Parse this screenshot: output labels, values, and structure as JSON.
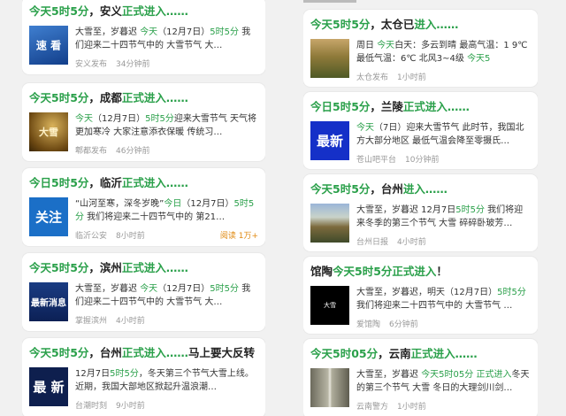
{
  "left": [
    {
      "title_parts": [
        {
          "text": "今天5时5分",
          "c": "g"
        },
        {
          "text": "，安义",
          "c": ""
        },
        {
          "text": "正式进入……",
          "c": "g"
        }
      ],
      "snippet_parts": [
        {
          "text": "大雪至，岁暮迟 ",
          "c": ""
        },
        {
          "text": "今天",
          "c": "g"
        },
        {
          "text": "（12月7日）",
          "c": ""
        },
        {
          "text": "5时5分",
          "c": "g"
        },
        {
          "text": " 我们迎来二十四节气中的 大雪节气 大…",
          "c": ""
        }
      ],
      "thumb": {
        "label": "速 看",
        "kind": "blue-grad"
      },
      "source": "安义发布",
      "time": "34分钟前"
    },
    {
      "title_parts": [
        {
          "text": "今天5时5分",
          "c": "g"
        },
        {
          "text": "，成都",
          "c": ""
        },
        {
          "text": "正式进入……",
          "c": "g"
        }
      ],
      "snippet_parts": [
        {
          "text": "今天",
          "c": "g"
        },
        {
          "text": "（12月7日）",
          "c": ""
        },
        {
          "text": "5时5分",
          "c": "g"
        },
        {
          "text": "迎来大雪节气 天气将更加寒冷 大家注意添衣保暖 传统习…",
          "c": ""
        }
      ],
      "thumb": {
        "label": "大雪",
        "kind": "gold"
      },
      "source": "郫都发布",
      "time": "46分钟前"
    },
    {
      "title_parts": [
        {
          "text": "今日5时5分",
          "c": "g"
        },
        {
          "text": "，临沂",
          "c": ""
        },
        {
          "text": "正式进入……",
          "c": "g"
        }
      ],
      "snippet_parts": [
        {
          "text": "“山河至寒，深冬岁晚”",
          "c": ""
        },
        {
          "text": "今日",
          "c": "g"
        },
        {
          "text": "（12月7日）",
          "c": ""
        },
        {
          "text": "5时5分",
          "c": "g"
        },
        {
          "text": " 我们将迎来二十四节气中的 第21…",
          "c": ""
        }
      ],
      "thumb": {
        "label": "关注",
        "kind": "blue"
      },
      "source": "临沂公安",
      "time": "8小时前",
      "reads": "阅读 1万+"
    },
    {
      "title_parts": [
        {
          "text": "今天5时5分",
          "c": "g"
        },
        {
          "text": "，滨州",
          "c": ""
        },
        {
          "text": "正式进入……",
          "c": "g"
        }
      ],
      "snippet_parts": [
        {
          "text": "大雪至，岁暮迟 ",
          "c": ""
        },
        {
          "text": "今天",
          "c": "g"
        },
        {
          "text": "（12月7日）",
          "c": ""
        },
        {
          "text": "5时5分",
          "c": "g"
        },
        {
          "text": " 我们迎来二十四节气中的 大雪节气 大…",
          "c": ""
        }
      ],
      "thumb": {
        "label": "最新消息",
        "kind": "navy"
      },
      "source": "掌握滨州",
      "time": "4小时前"
    },
    {
      "title_parts": [
        {
          "text": "今天5时5分",
          "c": "g"
        },
        {
          "text": "，台州",
          "c": ""
        },
        {
          "text": "正式进入……",
          "c": "g"
        },
        {
          "text": "马上要大反转",
          "c": ""
        }
      ],
      "snippet_parts": [
        {
          "text": "12月7日",
          "c": ""
        },
        {
          "text": "5时5分",
          "c": "g"
        },
        {
          "text": "，冬天第三个节气大雪上线。近期，我国大部地区掀起升温浪潮…",
          "c": ""
        }
      ],
      "thumb": {
        "label": "最 新",
        "kind": "darknavy"
      },
      "source": "台潮时刻",
      "time": "9小时前"
    }
  ],
  "right": [
    {
      "title_parts": [
        {
          "text": "今天5时5分",
          "c": "g"
        },
        {
          "text": "，太仓已",
          "c": ""
        },
        {
          "text": "进入……",
          "c": "g"
        }
      ],
      "snippet_parts": [
        {
          "text": "周日 ",
          "c": ""
        },
        {
          "text": "今天",
          "c": "g"
        },
        {
          "text": "白天：多云到晴 最高气温：1 9℃ 最低气温：6℃ 北风3~4级 ",
          "c": ""
        },
        {
          "text": "今天5",
          "c": "g"
        }
      ],
      "thumb": {
        "label": "",
        "kind": "field"
      },
      "source": "太仓发布",
      "time": "1小时前"
    },
    {
      "title_parts": [
        {
          "text": "今日5时5分",
          "c": "g"
        },
        {
          "text": "，兰陵",
          "c": ""
        },
        {
          "text": "正式进入……",
          "c": "g"
        }
      ],
      "snippet_parts": [
        {
          "text": "今天",
          "c": "g"
        },
        {
          "text": "（7日）迎来大雪节气 此时节，我国北方大部分地区 最低气温会降至零摄氏…",
          "c": ""
        }
      ],
      "thumb": {
        "label": "最新",
        "kind": "royal"
      },
      "source": "苍山吧平台",
      "time": "10分钟前"
    },
    {
      "title_parts": [
        {
          "text": "今天5时5分",
          "c": "g"
        },
        {
          "text": "，台州",
          "c": ""
        },
        {
          "text": "进入……",
          "c": "g"
        }
      ],
      "snippet_parts": [
        {
          "text": "大雪至，岁暮迟 12月7日",
          "c": ""
        },
        {
          "text": "5时5分",
          "c": "g"
        },
        {
          "text": " 我们将迎来冬季的第三个节气 大雪 碎碎卧玻芳…",
          "c": ""
        }
      ],
      "thumb": {
        "label": "",
        "kind": "village"
      },
      "source": "台州日报",
      "time": "4小时前"
    },
    {
      "title_parts": [
        {
          "text": "馆陶",
          "c": ""
        },
        {
          "text": "今天5时5分正式进入",
          "c": "g"
        },
        {
          "text": "！",
          "c": ""
        }
      ],
      "snippet_parts": [
        {
          "text": "大雪至，岁暮迟，明天（12月7日）",
          "c": ""
        },
        {
          "text": "5时5分",
          "c": "g"
        },
        {
          "text": " 我们将迎来二十四节气中的 大雪节气 …",
          "c": ""
        }
      ],
      "thumb": {
        "label": "大雪",
        "kind": "black"
      },
      "source": "爱馆陶",
      "time": "6分钟前"
    },
    {
      "title_parts": [
        {
          "text": "今天5时05分",
          "c": "g"
        },
        {
          "text": "，云南",
          "c": ""
        },
        {
          "text": "正式进入……",
          "c": "g"
        }
      ],
      "snippet_parts": [
        {
          "text": "大雪至，岁暮迟 ",
          "c": ""
        },
        {
          "text": "今天5时05分 正式进入",
          "c": "g"
        },
        {
          "text": "冬天的第三个节气 大雪 冬日的大理剑川剑…",
          "c": ""
        }
      ],
      "thumb": {
        "label": "",
        "kind": "trees"
      },
      "source": "云南警方",
      "time": "1小时前"
    }
  ]
}
